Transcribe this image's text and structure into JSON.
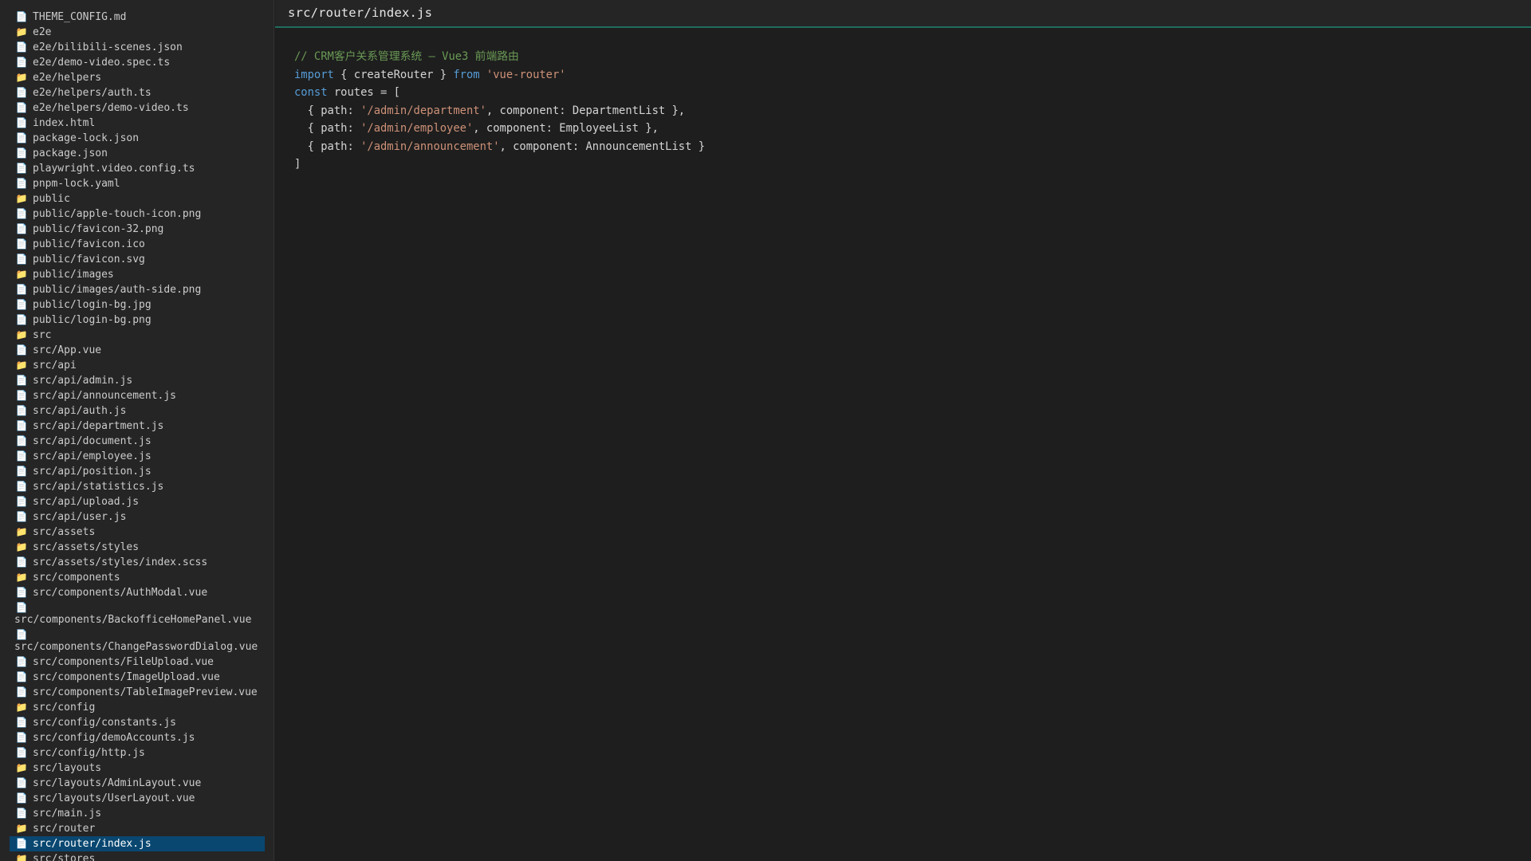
{
  "window": {
    "active_file": "src/router/index.js"
  },
  "colors": {
    "sidebar_bg": "#252526",
    "editor_bg": "#1e1e1e",
    "selection_bg": "#094771",
    "tab_underline": "#1f6d5e",
    "comment": "#6a9955",
    "keyword": "#569cd6",
    "string": "#ce9178",
    "text": "#d4d4d4"
  },
  "sidebar": {
    "items": [
      {
        "label": "THEME_CONFIG.md",
        "type": "file",
        "icon": "file-icon"
      },
      {
        "label": "e2e",
        "type": "folder",
        "icon": "folder-icon"
      },
      {
        "label": "e2e/bilibili-scenes.json",
        "type": "file",
        "icon": "file-icon"
      },
      {
        "label": "e2e/demo-video.spec.ts",
        "type": "file",
        "icon": "file-icon"
      },
      {
        "label": "e2e/helpers",
        "type": "folder",
        "icon": "folder-icon"
      },
      {
        "label": "e2e/helpers/auth.ts",
        "type": "file",
        "icon": "file-icon"
      },
      {
        "label": "e2e/helpers/demo-video.ts",
        "type": "file",
        "icon": "file-icon"
      },
      {
        "label": "index.html",
        "type": "file",
        "icon": "file-icon"
      },
      {
        "label": "package-lock.json",
        "type": "file",
        "icon": "file-icon"
      },
      {
        "label": "package.json",
        "type": "file",
        "icon": "file-icon"
      },
      {
        "label": "playwright.video.config.ts",
        "type": "file",
        "icon": "file-icon"
      },
      {
        "label": "pnpm-lock.yaml",
        "type": "file",
        "icon": "file-icon"
      },
      {
        "label": "public",
        "type": "folder",
        "icon": "folder-icon"
      },
      {
        "label": "public/apple-touch-icon.png",
        "type": "file",
        "icon": "file-icon"
      },
      {
        "label": "public/favicon-32.png",
        "type": "file",
        "icon": "file-icon"
      },
      {
        "label": "public/favicon.ico",
        "type": "file",
        "icon": "file-icon"
      },
      {
        "label": "public/favicon.svg",
        "type": "file",
        "icon": "file-icon"
      },
      {
        "label": "public/images",
        "type": "folder",
        "icon": "folder-icon"
      },
      {
        "label": "public/images/auth-side.png",
        "type": "file",
        "icon": "file-icon"
      },
      {
        "label": "public/login-bg.jpg",
        "type": "file",
        "icon": "file-icon"
      },
      {
        "label": "public/login-bg.png",
        "type": "file",
        "icon": "file-icon"
      },
      {
        "label": "src",
        "type": "folder",
        "icon": "folder-icon"
      },
      {
        "label": "src/App.vue",
        "type": "file",
        "icon": "file-icon"
      },
      {
        "label": "src/api",
        "type": "folder",
        "icon": "folder-icon"
      },
      {
        "label": "src/api/admin.js",
        "type": "file",
        "icon": "file-icon"
      },
      {
        "label": "src/api/announcement.js",
        "type": "file",
        "icon": "file-icon"
      },
      {
        "label": "src/api/auth.js",
        "type": "file",
        "icon": "file-icon"
      },
      {
        "label": "src/api/department.js",
        "type": "file",
        "icon": "file-icon"
      },
      {
        "label": "src/api/document.js",
        "type": "file",
        "icon": "file-icon"
      },
      {
        "label": "src/api/employee.js",
        "type": "file",
        "icon": "file-icon"
      },
      {
        "label": "src/api/position.js",
        "type": "file",
        "icon": "file-icon"
      },
      {
        "label": "src/api/statistics.js",
        "type": "file",
        "icon": "file-icon"
      },
      {
        "label": "src/api/upload.js",
        "type": "file",
        "icon": "file-icon"
      },
      {
        "label": "src/api/user.js",
        "type": "file",
        "icon": "file-icon"
      },
      {
        "label": "src/assets",
        "type": "folder",
        "icon": "folder-icon"
      },
      {
        "label": "src/assets/styles",
        "type": "folder",
        "icon": "folder-icon"
      },
      {
        "label": "src/assets/styles/index.scss",
        "type": "file",
        "icon": "file-icon"
      },
      {
        "label": "src/components",
        "type": "folder",
        "icon": "folder-icon"
      },
      {
        "label": "src/components/AuthModal.vue",
        "type": "file",
        "icon": "file-icon"
      },
      {
        "label": "src/components/BackofficeHomePanel.vue",
        "type": "file",
        "icon": "file-icon",
        "wrap": true
      },
      {
        "label": "src/components/ChangePasswordDialog.vue",
        "type": "file",
        "icon": "file-icon",
        "wrap": true
      },
      {
        "label": "src/components/FileUpload.vue",
        "type": "file",
        "icon": "file-icon"
      },
      {
        "label": "src/components/ImageUpload.vue",
        "type": "file",
        "icon": "file-icon"
      },
      {
        "label": "src/components/TableImagePreview.vue",
        "type": "file",
        "icon": "file-icon"
      },
      {
        "label": "src/config",
        "type": "folder",
        "icon": "folder-icon"
      },
      {
        "label": "src/config/constants.js",
        "type": "file",
        "icon": "file-icon"
      },
      {
        "label": "src/config/demoAccounts.js",
        "type": "file",
        "icon": "file-icon"
      },
      {
        "label": "src/config/http.js",
        "type": "file",
        "icon": "file-icon"
      },
      {
        "label": "src/layouts",
        "type": "folder",
        "icon": "folder-icon"
      },
      {
        "label": "src/layouts/AdminLayout.vue",
        "type": "file",
        "icon": "file-icon"
      },
      {
        "label": "src/layouts/UserLayout.vue",
        "type": "file",
        "icon": "file-icon"
      },
      {
        "label": "src/main.js",
        "type": "file",
        "icon": "file-icon"
      },
      {
        "label": "src/router",
        "type": "folder",
        "icon": "folder-icon"
      },
      {
        "label": "src/router/index.js",
        "type": "file",
        "icon": "file-icon",
        "selected": true
      },
      {
        "label": "src/stores",
        "type": "folder",
        "icon": "folder-icon"
      }
    ]
  },
  "editor": {
    "tab_title": "src/router/index.js",
    "lines": [
      [
        {
          "t": "comment",
          "text": "// CRM客户关系管理系统 — Vue3 前端路由"
        }
      ],
      [
        {
          "t": "keyword",
          "text": "import"
        },
        {
          "t": "plain",
          "text": " { createRouter } "
        },
        {
          "t": "keyword",
          "text": "from"
        },
        {
          "t": "plain",
          "text": " "
        },
        {
          "t": "string",
          "text": "'vue-router'"
        }
      ],
      [
        {
          "t": "keyword",
          "text": "const"
        },
        {
          "t": "plain",
          "text": " routes = ["
        }
      ],
      [
        {
          "t": "plain",
          "text": "  { path: "
        },
        {
          "t": "string",
          "text": "'/admin/department'"
        },
        {
          "t": "plain",
          "text": ", component: DepartmentList },"
        }
      ],
      [
        {
          "t": "plain",
          "text": "  { path: "
        },
        {
          "t": "string",
          "text": "'/admin/employee'"
        },
        {
          "t": "plain",
          "text": ", component: EmployeeList },"
        }
      ],
      [
        {
          "t": "plain",
          "text": "  { path: "
        },
        {
          "t": "string",
          "text": "'/admin/announcement'"
        },
        {
          "t": "plain",
          "text": ", component: AnnouncementList }"
        }
      ],
      [
        {
          "t": "plain",
          "text": "]"
        }
      ]
    ]
  }
}
